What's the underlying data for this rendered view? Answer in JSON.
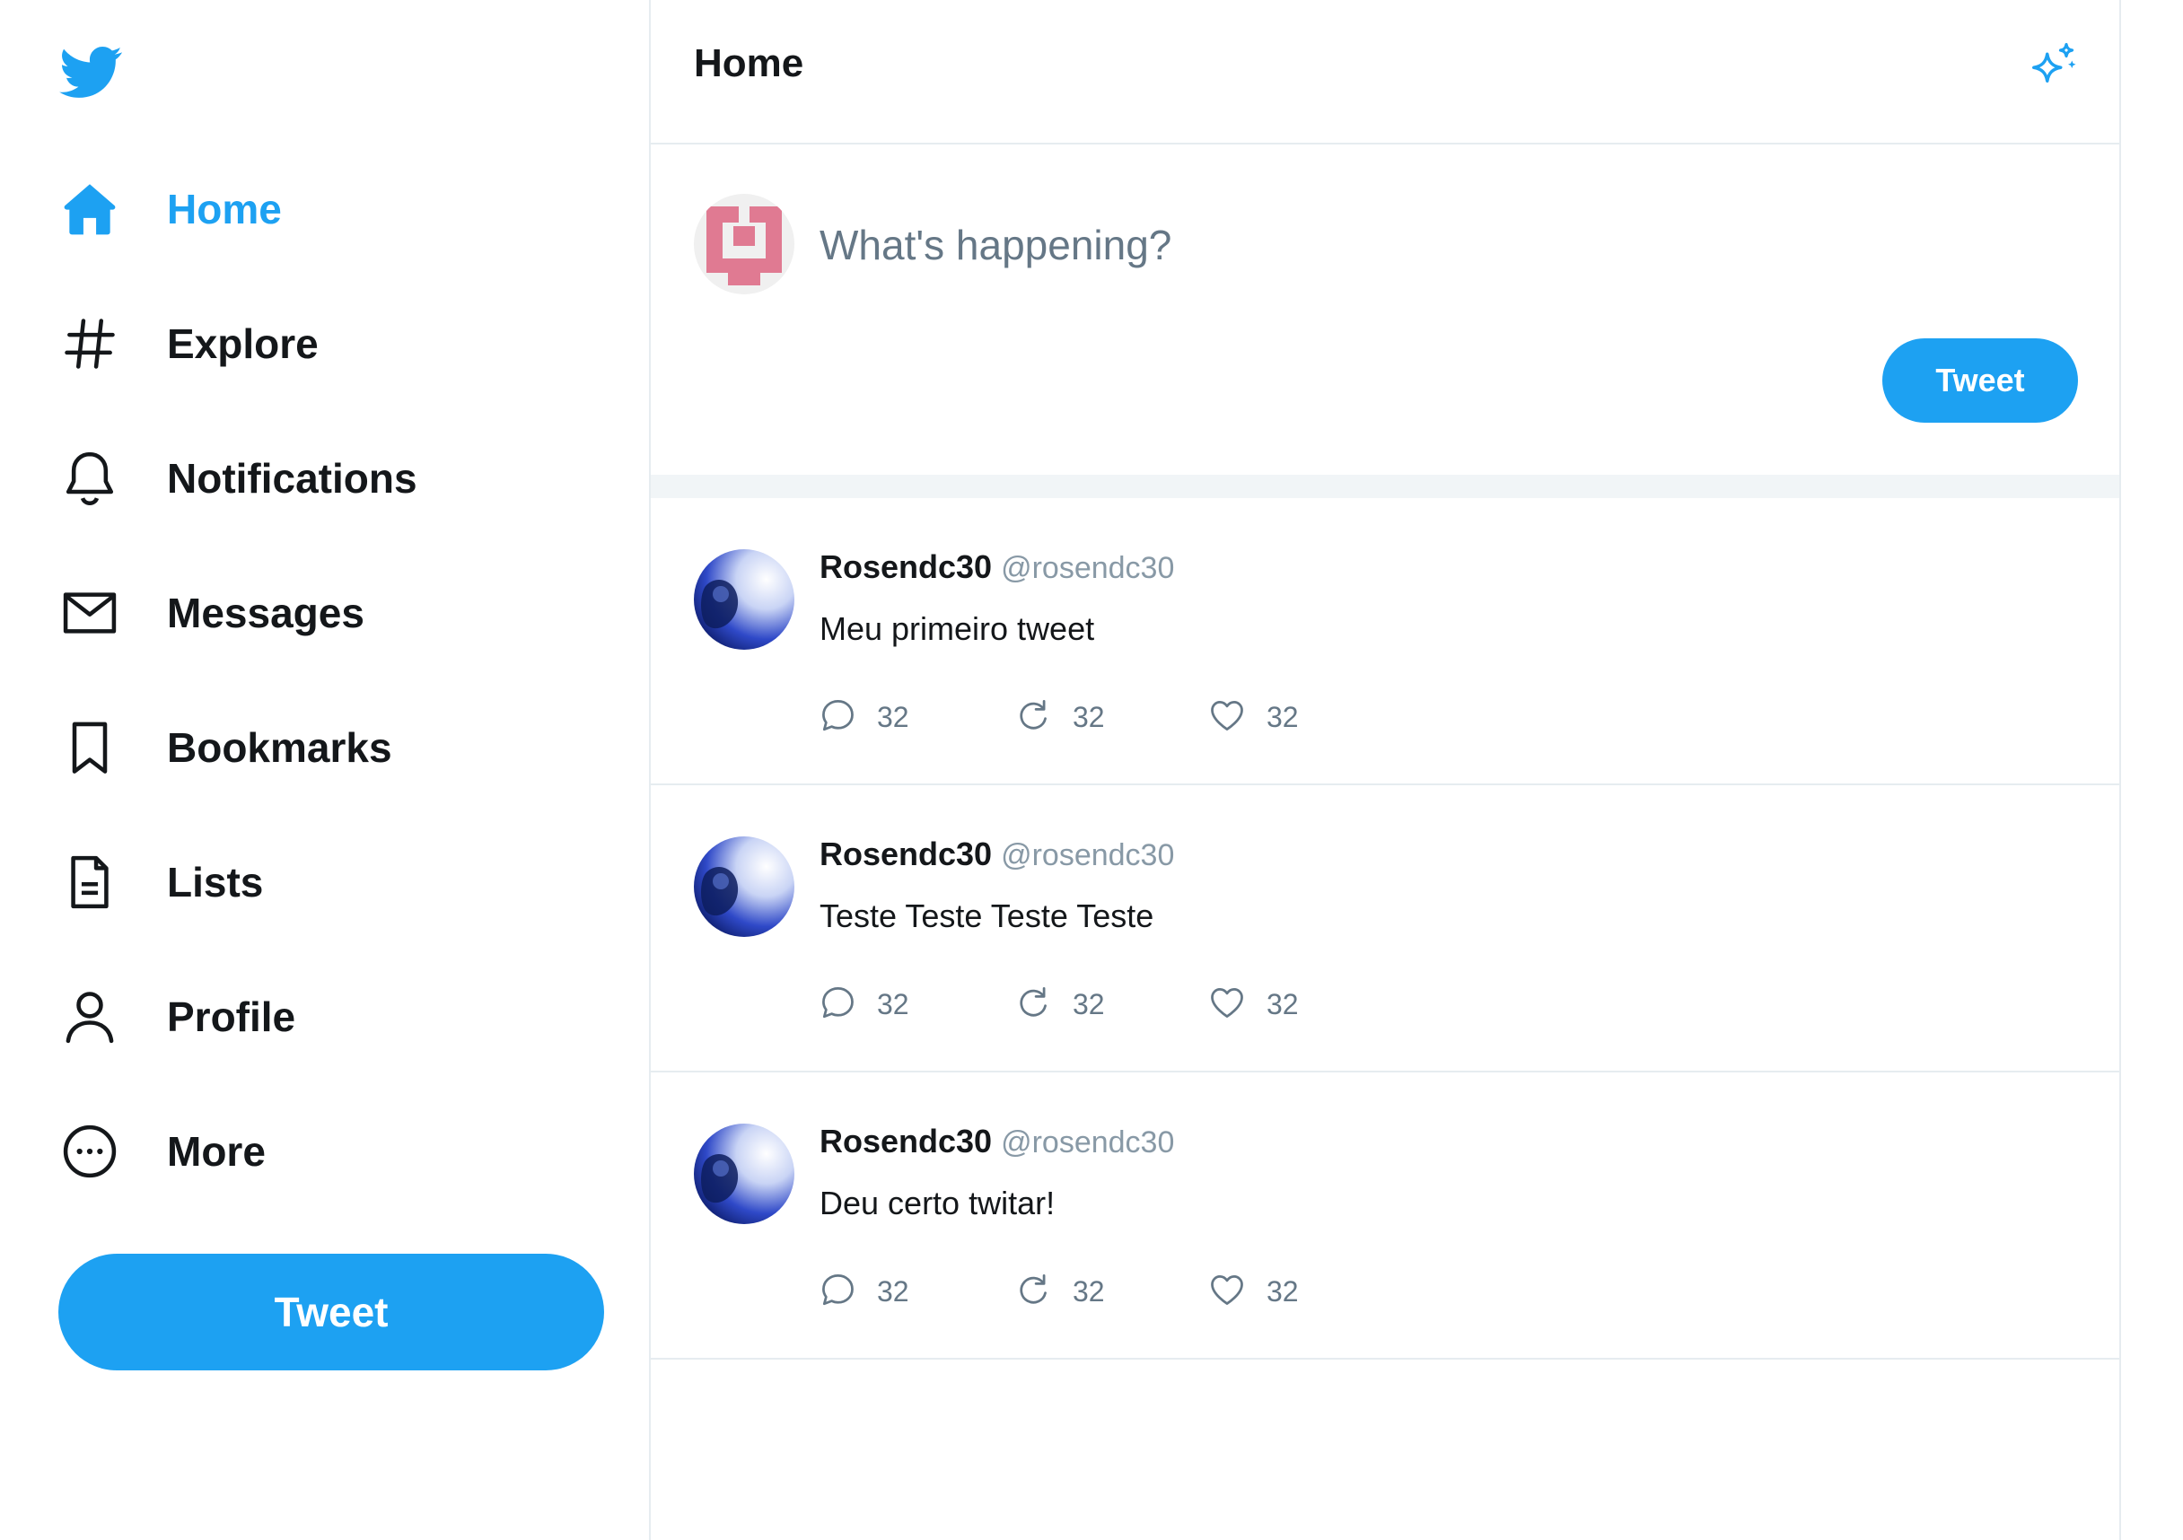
{
  "colors": {
    "accent": "#1da1f2",
    "text": "#14171a",
    "muted": "#657786",
    "border": "#e6ecf0"
  },
  "sidebar": {
    "logo_icon": "twitter-bird-icon",
    "items": [
      {
        "label": "Home",
        "icon": "home-icon",
        "active": true
      },
      {
        "label": "Explore",
        "icon": "hashtag-icon"
      },
      {
        "label": "Notifications",
        "icon": "bell-icon"
      },
      {
        "label": "Messages",
        "icon": "envelope-icon"
      },
      {
        "label": "Bookmarks",
        "icon": "bookmark-icon"
      },
      {
        "label": "Lists",
        "icon": "list-document-icon"
      },
      {
        "label": "Profile",
        "icon": "user-icon"
      },
      {
        "label": "More",
        "icon": "more-circle-icon"
      }
    ],
    "tweet_button": "Tweet"
  },
  "header": {
    "title": "Home",
    "action_icon": "sparkle-icon"
  },
  "composer": {
    "placeholder": "What's happening?",
    "value": "",
    "tweet_button": "Tweet"
  },
  "tweets": [
    {
      "name": "Rosendc30",
      "handle": "@rosendc30",
      "text": "Meu primeiro tweet",
      "replies": "32",
      "retweets": "32",
      "likes": "32"
    },
    {
      "name": "Rosendc30",
      "handle": "@rosendc30",
      "text": "Teste Teste Teste Teste",
      "replies": "32",
      "retweets": "32",
      "likes": "32"
    },
    {
      "name": "Rosendc30",
      "handle": "@rosendc30",
      "text": "Deu certo twitar!",
      "replies": "32",
      "retweets": "32",
      "likes": "32"
    }
  ]
}
